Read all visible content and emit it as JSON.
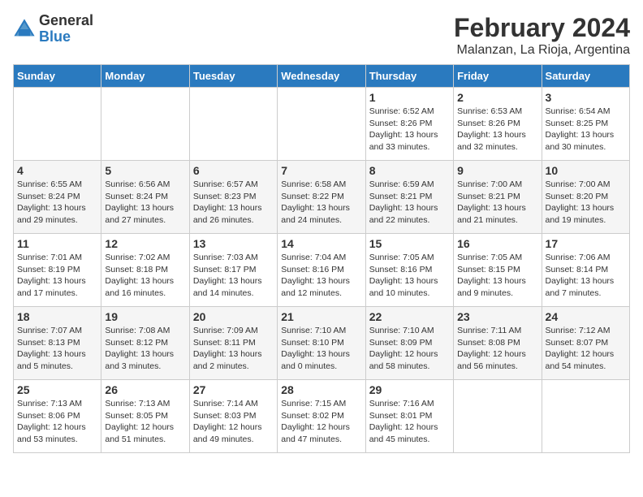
{
  "header": {
    "logo_general": "General",
    "logo_blue": "Blue",
    "month_year": "February 2024",
    "location": "Malanzan, La Rioja, Argentina"
  },
  "calendar": {
    "days_of_week": [
      "Sunday",
      "Monday",
      "Tuesday",
      "Wednesday",
      "Thursday",
      "Friday",
      "Saturday"
    ],
    "weeks": [
      [
        {
          "day": "",
          "info": ""
        },
        {
          "day": "",
          "info": ""
        },
        {
          "day": "",
          "info": ""
        },
        {
          "day": "",
          "info": ""
        },
        {
          "day": "1",
          "info": "Sunrise: 6:52 AM\nSunset: 8:26 PM\nDaylight: 13 hours and 33 minutes."
        },
        {
          "day": "2",
          "info": "Sunrise: 6:53 AM\nSunset: 8:26 PM\nDaylight: 13 hours and 32 minutes."
        },
        {
          "day": "3",
          "info": "Sunrise: 6:54 AM\nSunset: 8:25 PM\nDaylight: 13 hours and 30 minutes."
        }
      ],
      [
        {
          "day": "4",
          "info": "Sunrise: 6:55 AM\nSunset: 8:24 PM\nDaylight: 13 hours and 29 minutes."
        },
        {
          "day": "5",
          "info": "Sunrise: 6:56 AM\nSunset: 8:24 PM\nDaylight: 13 hours and 27 minutes."
        },
        {
          "day": "6",
          "info": "Sunrise: 6:57 AM\nSunset: 8:23 PM\nDaylight: 13 hours and 26 minutes."
        },
        {
          "day": "7",
          "info": "Sunrise: 6:58 AM\nSunset: 8:22 PM\nDaylight: 13 hours and 24 minutes."
        },
        {
          "day": "8",
          "info": "Sunrise: 6:59 AM\nSunset: 8:21 PM\nDaylight: 13 hours and 22 minutes."
        },
        {
          "day": "9",
          "info": "Sunrise: 7:00 AM\nSunset: 8:21 PM\nDaylight: 13 hours and 21 minutes."
        },
        {
          "day": "10",
          "info": "Sunrise: 7:00 AM\nSunset: 8:20 PM\nDaylight: 13 hours and 19 minutes."
        }
      ],
      [
        {
          "day": "11",
          "info": "Sunrise: 7:01 AM\nSunset: 8:19 PM\nDaylight: 13 hours and 17 minutes."
        },
        {
          "day": "12",
          "info": "Sunrise: 7:02 AM\nSunset: 8:18 PM\nDaylight: 13 hours and 16 minutes."
        },
        {
          "day": "13",
          "info": "Sunrise: 7:03 AM\nSunset: 8:17 PM\nDaylight: 13 hours and 14 minutes."
        },
        {
          "day": "14",
          "info": "Sunrise: 7:04 AM\nSunset: 8:16 PM\nDaylight: 13 hours and 12 minutes."
        },
        {
          "day": "15",
          "info": "Sunrise: 7:05 AM\nSunset: 8:16 PM\nDaylight: 13 hours and 10 minutes."
        },
        {
          "day": "16",
          "info": "Sunrise: 7:05 AM\nSunset: 8:15 PM\nDaylight: 13 hours and 9 minutes."
        },
        {
          "day": "17",
          "info": "Sunrise: 7:06 AM\nSunset: 8:14 PM\nDaylight: 13 hours and 7 minutes."
        }
      ],
      [
        {
          "day": "18",
          "info": "Sunrise: 7:07 AM\nSunset: 8:13 PM\nDaylight: 13 hours and 5 minutes."
        },
        {
          "day": "19",
          "info": "Sunrise: 7:08 AM\nSunset: 8:12 PM\nDaylight: 13 hours and 3 minutes."
        },
        {
          "day": "20",
          "info": "Sunrise: 7:09 AM\nSunset: 8:11 PM\nDaylight: 13 hours and 2 minutes."
        },
        {
          "day": "21",
          "info": "Sunrise: 7:10 AM\nSunset: 8:10 PM\nDaylight: 13 hours and 0 minutes."
        },
        {
          "day": "22",
          "info": "Sunrise: 7:10 AM\nSunset: 8:09 PM\nDaylight: 12 hours and 58 minutes."
        },
        {
          "day": "23",
          "info": "Sunrise: 7:11 AM\nSunset: 8:08 PM\nDaylight: 12 hours and 56 minutes."
        },
        {
          "day": "24",
          "info": "Sunrise: 7:12 AM\nSunset: 8:07 PM\nDaylight: 12 hours and 54 minutes."
        }
      ],
      [
        {
          "day": "25",
          "info": "Sunrise: 7:13 AM\nSunset: 8:06 PM\nDaylight: 12 hours and 53 minutes."
        },
        {
          "day": "26",
          "info": "Sunrise: 7:13 AM\nSunset: 8:05 PM\nDaylight: 12 hours and 51 minutes."
        },
        {
          "day": "27",
          "info": "Sunrise: 7:14 AM\nSunset: 8:03 PM\nDaylight: 12 hours and 49 minutes."
        },
        {
          "day": "28",
          "info": "Sunrise: 7:15 AM\nSunset: 8:02 PM\nDaylight: 12 hours and 47 minutes."
        },
        {
          "day": "29",
          "info": "Sunrise: 7:16 AM\nSunset: 8:01 PM\nDaylight: 12 hours and 45 minutes."
        },
        {
          "day": "",
          "info": ""
        },
        {
          "day": "",
          "info": ""
        }
      ]
    ]
  }
}
